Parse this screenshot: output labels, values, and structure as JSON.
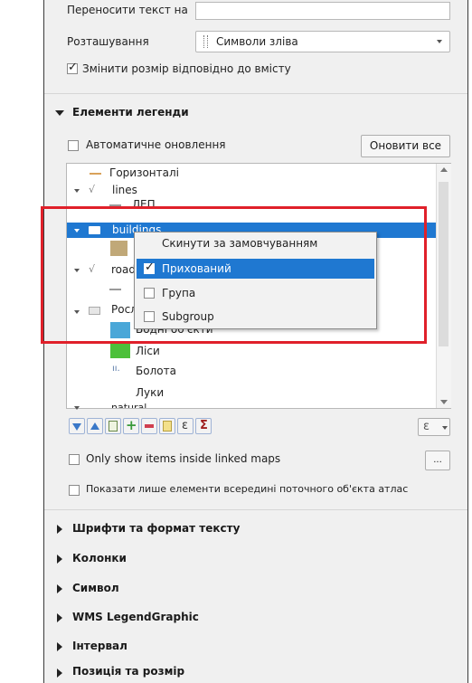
{
  "top_rows": {
    "wrap_label": "Переносити текст на",
    "position_label": "Розташування",
    "position_value": "Символи зліва",
    "resize_label": "Змінити розмір відповідно до вмісту"
  },
  "legend_items": {
    "section_title": "Елементи легенди",
    "auto_update_label": "Автоматичне оновлення",
    "update_all_button": "Оновити все",
    "tree": [
      {
        "label": "Горизонталі"
      },
      {
        "label": "lines"
      },
      {
        "label": "ЛЕП"
      },
      {
        "label": "buildings"
      },
      {
        "label": "roads"
      },
      {
        "label": "Рослинність"
      },
      {
        "label": "Водні об'єкти"
      },
      {
        "label": "Ліси"
      },
      {
        "label": "Болота"
      },
      {
        "label": "Луки"
      },
      {
        "label": "natural"
      }
    ],
    "context_menu": {
      "reset": "Скинути за замовчуванням",
      "hidden": "Прихований",
      "group": "Група",
      "subgroup": "Subgroup"
    },
    "toolbar": {
      "filter_symbol": "ε",
      "sigma_symbol": "Σ",
      "expr_symbol": "ε"
    },
    "only_linked_label": "Only show items inside linked maps",
    "more_button": "...",
    "atlas_label": "Показати лише елементи всередині поточного об'єкта атлас"
  },
  "sections": [
    "Шрифти та формат тексту",
    "Колонки",
    "Символ",
    "WMS LegendGraphic",
    "Інтервал",
    "Позиція та розмір"
  ],
  "colors": {
    "highlight": "#1f78d1",
    "annotation_red": "#e0202a",
    "checked_blue": "#1f4f9a"
  }
}
